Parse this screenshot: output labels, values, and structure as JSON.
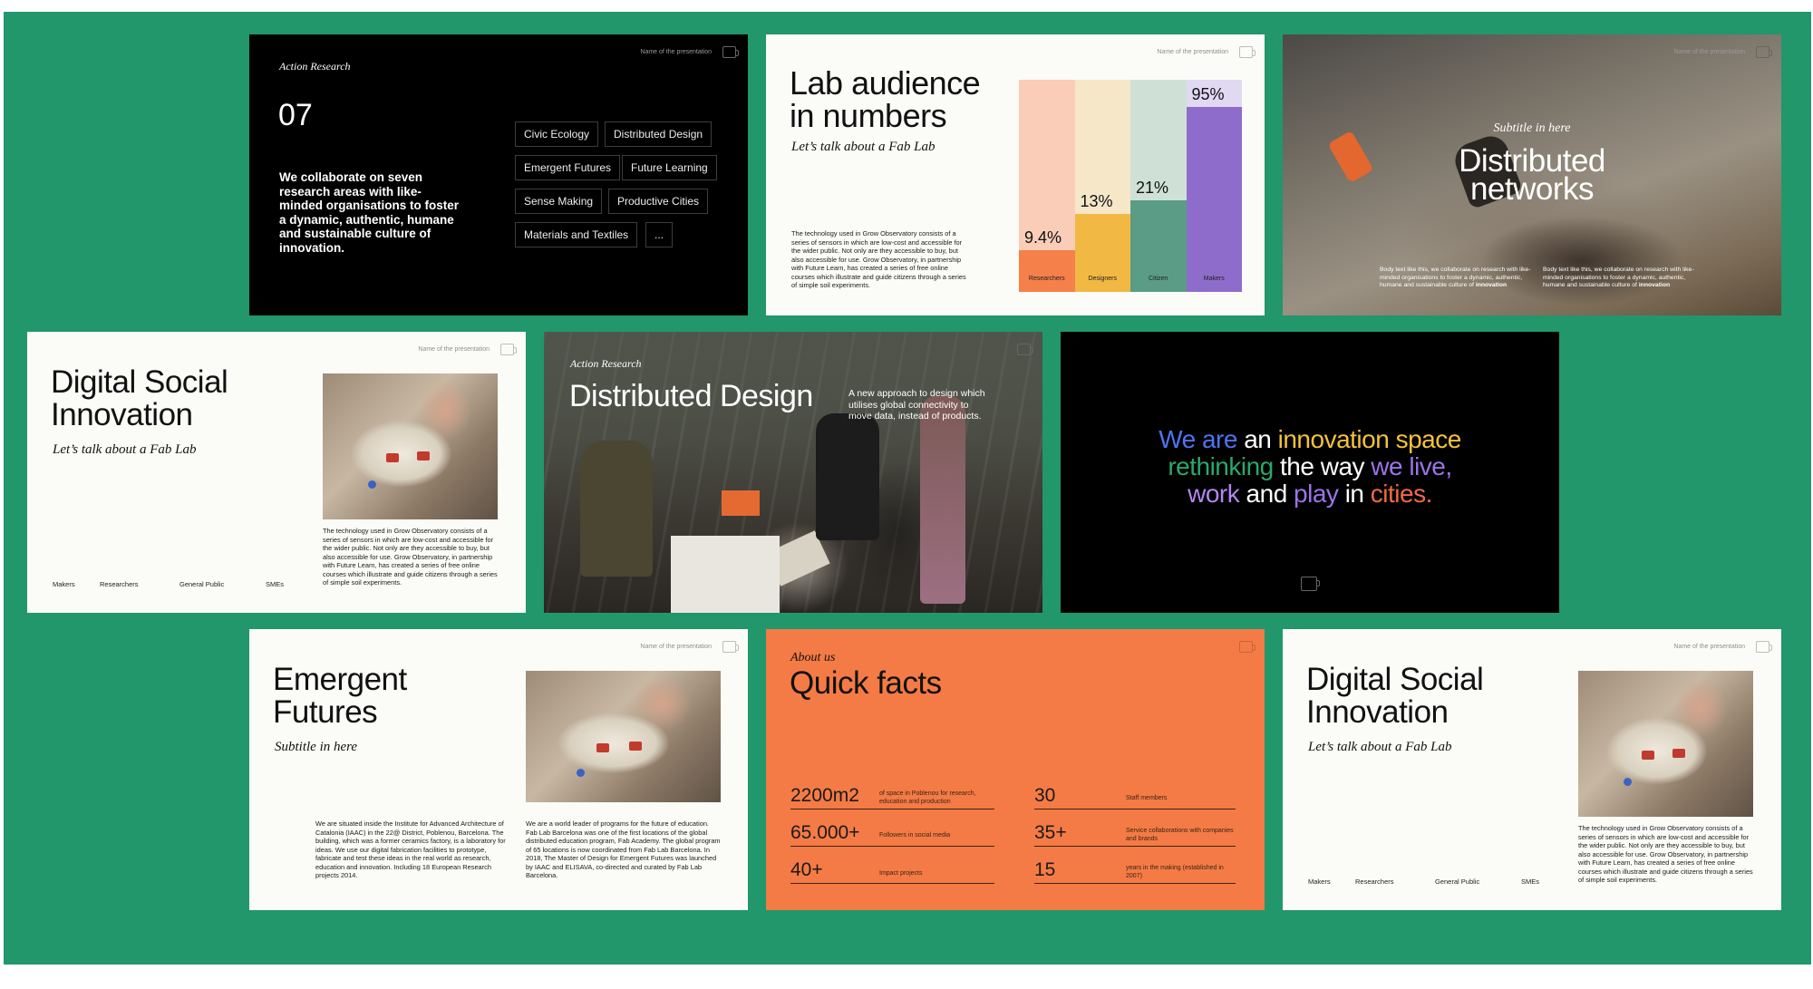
{
  "slide_action_research": {
    "kicker": "Action Research",
    "number": "07",
    "body": "We collaborate on seven research areas with like-minded organisations to foster a dynamic, authentic, humane and sustainable culture of innovation.",
    "presentation_name": "Name of the presentation",
    "chips": [
      "Civic Ecology",
      "Distributed Design",
      "Emergent Futures",
      "Future Learning",
      "Sense Making",
      "Productive Cities",
      "Materials and Textiles",
      "..."
    ]
  },
  "slide_audience": {
    "title_line1": "Lab audience",
    "title_line2": "in numbers",
    "subtitle": "Let’s talk about a Fab Lab",
    "body": "The technology used in Grow Observatory consists of a series of sensors in which are low-cost and accessible for the wider public. Not only are they accessible to buy, but also accessible for use. Grow Observatory, in partnership with Future Learn, has created a series of free online courses which illustrate and guide citizens through a series of simple soil experiments.",
    "presentation_name": "Name of the presentation"
  },
  "chart_data": {
    "type": "bar",
    "categories": [
      "Researchers",
      "Designers",
      "Citizen",
      "Makers"
    ],
    "values": [
      9.4,
      13,
      21,
      95
    ],
    "value_labels": [
      "9.4%",
      "13%",
      "21%",
      "95%"
    ],
    "ylim": [
      0,
      100
    ],
    "colors": [
      "#f5804a",
      "#f1b844",
      "#5a9c86",
      "#8d6ccc"
    ],
    "background_colors": [
      "#f9cdb7",
      "#f6e7c9",
      "#cfe1d6",
      "#e1d8f2"
    ]
  },
  "slide_distributed_networks": {
    "subtitle": "Subtitle in here",
    "title_line1": "Distributed",
    "title_line2": "networks",
    "presentation_name": "Name of the presentation",
    "body_left_prefix": "Body text like this, we collaborate on research with like-minded organisations to foster a dynamic, authentic, humane and sustainable culture of ",
    "body_left_bold": "innovation",
    "body_right_prefix": "Body text like this, we collaborate on research with like-minded organisations to foster a dynamic, authentic, humane and sustainable culture of ",
    "body_right_bold": "innovation"
  },
  "slide_dsi_a": {
    "title_line1": "Digital Social",
    "title_line2": "Innovation",
    "subtitle": "Let’s talk about a Fab Lab",
    "presentation_name": "Name of the presentation",
    "body": "The technology used in Grow Observatory consists of a series of sensors in which are low-cost and accessible for the wider public. Not only are they accessible to buy, but also accessible for use. Grow Observatory, in partnership with Future Learn, has created a series of free online courses which illustrate and guide citizens through a series of simple soil experiments.",
    "labels": [
      "Makers",
      "Researchers",
      "General Public",
      "SMEs"
    ]
  },
  "slide_distributed_design": {
    "kicker": "Action Research",
    "title": "Distributed Design",
    "description": "A new approach to design which utilises global connectivity to move data, instead of products."
  },
  "slide_statement": {
    "parts": [
      {
        "text": "We are",
        "color": "#4f74f0"
      },
      {
        "text": " an ",
        "color": "#ffffff"
      },
      {
        "text": "innovation space",
        "color": "#f5c23c"
      },
      {
        "text": "rethinking",
        "color": "#2ba86c"
      },
      {
        "text": " the way ",
        "color": "#ffffff"
      },
      {
        "text": "we live,",
        "color": "#9b74e8"
      },
      {
        "text": "work",
        "color": "#b386f0"
      },
      {
        "text": " and ",
        "color": "#ffffff"
      },
      {
        "text": "play",
        "color": "#9b74e8"
      },
      {
        "text": " in ",
        "color": "#ffffff"
      },
      {
        "text": "cities.",
        "color": "#f06a43"
      }
    ]
  },
  "slide_emergent": {
    "title_line1": "Emergent",
    "title_line2": "Futures",
    "subtitle": "Subtitle in here",
    "presentation_name": "Name of the presentation",
    "body_left": "We are situated inside the Institute for Advanced Architecture of Catalonia (IAAC) in the 22@ District, Poblenou, Barcelona. The building, which was a former ceramics factory, is a laboratory for ideas. We use our digital fabrication facilities to prototype, fabricate and test these ideas in the real world as research, education and innovation. Including 18 European Research projects 2014.",
    "body_right": "We are a world leader of programs for the future of education. Fab Lab Barcelona was one of the first locations of the global distributed education program, Fab Academy. The global program of 65 locations is now coordinated from Fab Lab Barcelona. In 2018, The Master of Design for Emergent Futures was launched by IAAC and ELISAVA, co-directed and curated by Fab Lab Barcelona."
  },
  "slide_quick_facts": {
    "kicker": "About us",
    "title": "Quick facts",
    "facts": [
      {
        "num": "2200m2",
        "desc": "of space in Poblenou for research, education and production"
      },
      {
        "num": "65.000+",
        "desc": "Followers in social media"
      },
      {
        "num": "40+",
        "desc": "Impact projects"
      },
      {
        "num": "30",
        "desc": "Staff members"
      },
      {
        "num": "35+",
        "desc": "Service collaborations with companies and brands"
      },
      {
        "num": "15",
        "desc": "years in the making (established in 2007)"
      }
    ]
  },
  "slide_dsi_b": {
    "title_line1": "Digital Social",
    "title_line2": "Innovation",
    "subtitle": "Let’s talk about a Fab Lab",
    "presentation_name": "Name of the presentation",
    "body": "The technology used in Grow Observatory consists of a series of sensors in which are low-cost and accessible for the wider public. Not only are they accessible to buy, but also accessible for use. Grow Observatory, in partnership with Future Learn, has created a series of free online courses which illustrate and guide citizens through a series of simple soil experiments.",
    "labels": [
      "Makers",
      "Researchers",
      "General Public",
      "SMEs"
    ]
  },
  "colors": {
    "background": "#21976b",
    "orange": "#f47b45",
    "black": "#000000",
    "paper": "#fbfbf8"
  }
}
